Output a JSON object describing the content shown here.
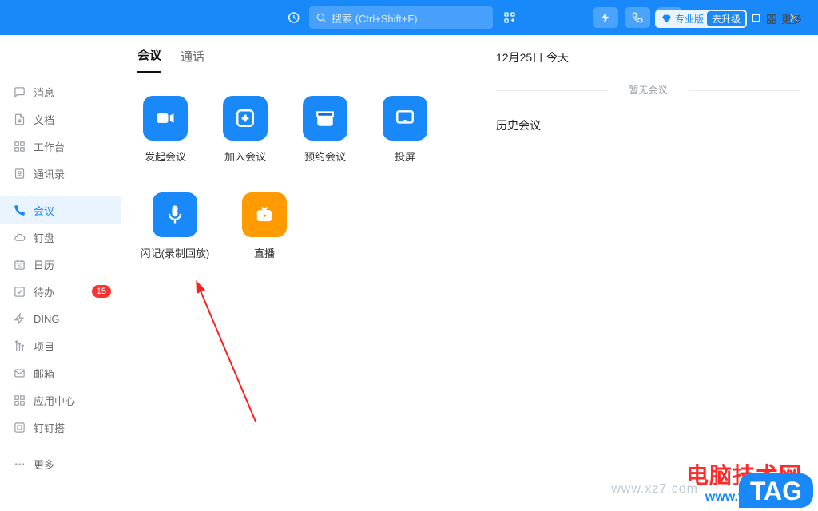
{
  "titlebar": {
    "search_placeholder": "搜索 (Ctrl+Shift+F)"
  },
  "sidebar": {
    "items": [
      {
        "label": "消息"
      },
      {
        "label": "文档"
      },
      {
        "label": "工作台"
      },
      {
        "label": "通讯录"
      },
      {
        "label": "会议"
      },
      {
        "label": "钉盘"
      },
      {
        "label": "日历"
      },
      {
        "label": "待办",
        "badge": "15"
      },
      {
        "label": "DING"
      },
      {
        "label": "项目"
      },
      {
        "label": "邮箱"
      },
      {
        "label": "应用中心"
      },
      {
        "label": "钉钉搭"
      },
      {
        "label": "更多"
      }
    ]
  },
  "tabs": {
    "meeting": "会议",
    "call": "通话",
    "pro_badge": "专业版",
    "upgrade": "去升级",
    "more": "更多"
  },
  "tiles": {
    "start": "发起会议",
    "join": "加入会议",
    "schedule": "预约会议",
    "cast": "投屏",
    "flash": "闪记(录制回放)",
    "live": "直播"
  },
  "rightcol": {
    "date": "12月25日 今天",
    "empty": "暂无会议",
    "history": "历史会议"
  },
  "watermark": {
    "line1": "电脑技术网",
    "line2": "www.tagxp.com",
    "tag": "TAG",
    "faint": "www.xz7.com"
  }
}
